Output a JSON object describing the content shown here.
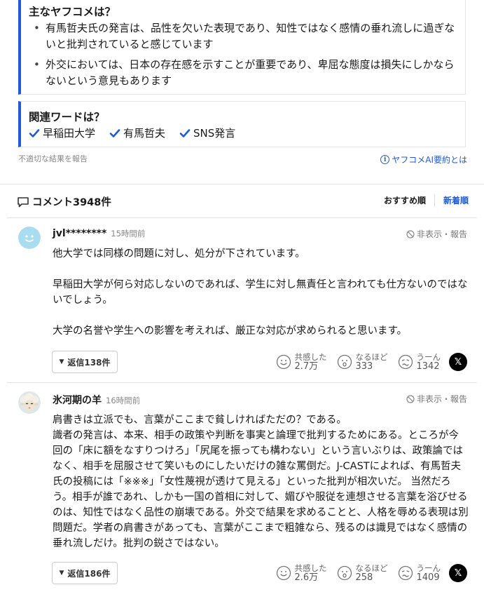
{
  "summary": {
    "title": "主なヤフコメは？",
    "bullets": [
      "有馬哲夫氏の発言は、品性を欠いた表現であり、知性ではなく感情の垂れ流しに過ぎないと批判されていると感じています",
      "外交においては、日本の存在感を示すことが重要であり、卑屈な態度は損失にしかならないという意見もあります"
    ]
  },
  "related": {
    "title": "関連ワードは？",
    "tags": [
      "早稲田大学",
      "有馬哲夫",
      "SNS発言"
    ]
  },
  "links": {
    "report": "不適切な結果を報告",
    "ai_summary": "ヤフコメAI要約とは"
  },
  "comments_header": {
    "title": "コメント3948件",
    "sort_recommended": "おすすめ順",
    "sort_newest": "新着順"
  },
  "colors": {
    "accent": "#1f5bd6",
    "text": "#1a1a1a",
    "muted": "#888888"
  },
  "comments": [
    {
      "user": "jvl********",
      "time": "15時間前",
      "hide_label": "非表示・報告",
      "body": "他大学では同様の問題に対し、処分が下されています。\n\n早稲田大学が何ら対応しないのであれば、学生に対し無責任と言われても仕方ないのではないでしょう。\n\n大学の名誉や学生への影響を考えれば、厳正な対応が求められると思います。",
      "reply_label": "返信138件",
      "reactions": {
        "empathy_label": "共感した",
        "empathy_count": "2.7万",
        "indeed_label": "なるほど",
        "indeed_count": "333",
        "hmm_label": "うーん",
        "hmm_count": "1342"
      },
      "share_icon": "x-logo-icon"
    },
    {
      "user": "氷河期の羊",
      "time": "16時間前",
      "hide_label": "非表示・報告",
      "body": "肩書きは立派でも、言葉がここまで貧しければただの？である。\n識者の発言は、本来、相手の政策や判断を事実と論理で批判するためにある。ところが今回の「床に額をなすりつけろ」「尻尾を振っても構わない」という言いぶりは、政策論ではなく、相手を屈服させて笑いものにしたいだけの雑な罵倒だ。J-CASTによれば、有馬哲夫氏の投稿には「※※※」「女性蔑視が透けて見える」といった批判が相次いだ。 当然だろう。相手が誰であれ、しかも一国の首相に対して、媚びや服従を連想させる言葉を浴びせるのは、知性ではなく品性の崩壊である。外交で結果を求めることと、人格を辱める表現は別問題だ。学者の肩書きがあっても、言葉がここまで粗雑なら、残るのは識見ではなく感情の垂れ流しだけ。批判の鋭さではない。",
      "reply_label": "返信186件",
      "reactions": {
        "empathy_label": "共感した",
        "empathy_count": "2.6万",
        "indeed_label": "なるほど",
        "indeed_count": "258",
        "hmm_label": "うーん",
        "hmm_count": "1409"
      },
      "share_icon": "x-logo-icon"
    }
  ]
}
